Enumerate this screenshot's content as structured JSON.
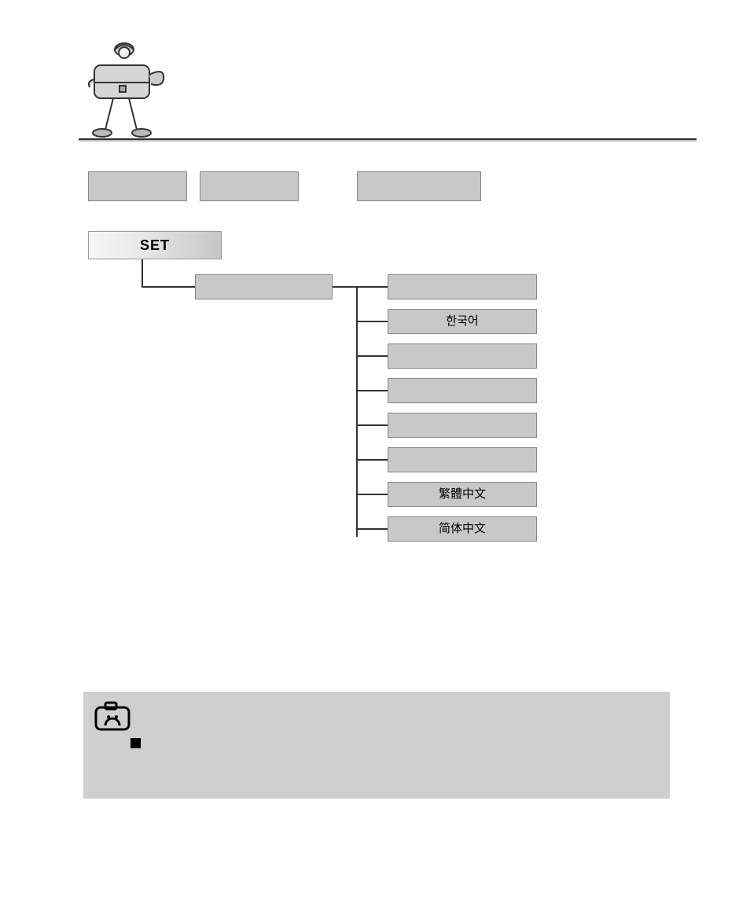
{
  "set_label": "SET",
  "lang_options": {
    "korean": "한국어",
    "trad_chinese": "繁體中文",
    "simp_chinese": "简体中文"
  }
}
